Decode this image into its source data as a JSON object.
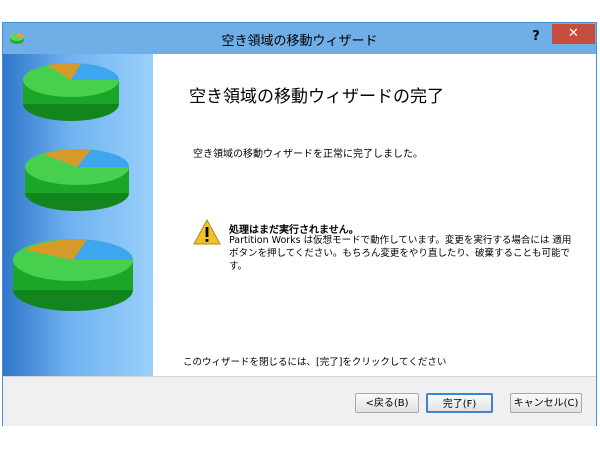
{
  "window": {
    "title": "空き領域の移動ウィザード",
    "help_label": "?",
    "close_label": "✕"
  },
  "content": {
    "heading": "空き領域の移動ウィザードの完了",
    "message": "空き領域の移動ウィザードを正常に完了しました。",
    "warning": {
      "title": "処理はまだ実行されません。",
      "body": "Partition Works は仮想モードで動作しています。変更を実行する場合には 適用 ボタンを押してください。もちろん変更をやり直したり、破棄することも可能です。"
    },
    "closing_note": "このウィザードを閉じるには、[完了]をクリックしてください"
  },
  "buttons": {
    "back": "<戻る(B)",
    "finish": "完了(F)",
    "cancel": "キャンセル(C)"
  },
  "colors": {
    "accent": "#6faee6",
    "close": "#c74d3f",
    "disk_green": "#1fae2a"
  },
  "icons": {
    "app": "partition-app-icon",
    "warning": "warning-icon",
    "sidebar": "disk-pie-icon"
  }
}
